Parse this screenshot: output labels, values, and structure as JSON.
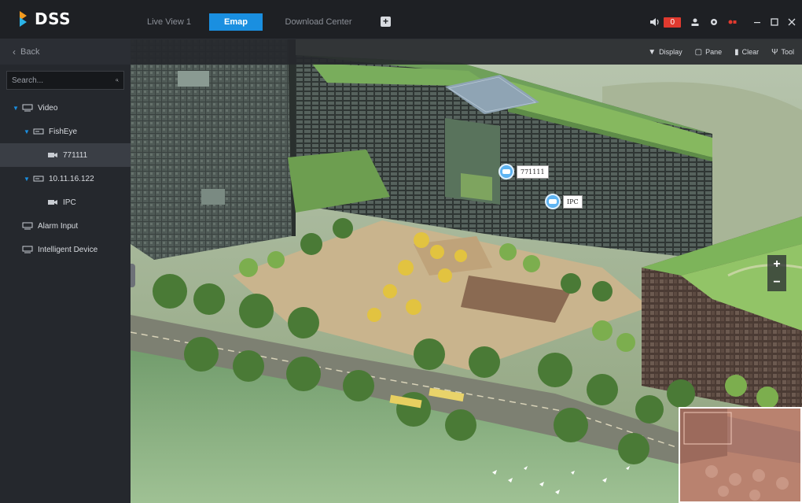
{
  "app": {
    "logo_text": "DSS"
  },
  "tabs": [
    {
      "label": "Live View 1",
      "active": false
    },
    {
      "label": "Emap",
      "active": true
    },
    {
      "label": "Download Center",
      "active": false
    }
  ],
  "header": {
    "alarm_count": "0"
  },
  "sidebar": {
    "back_label": "Back",
    "search_placeholder": "Search...",
    "tree": {
      "video": "Video",
      "fisheye": "FishEye",
      "fisheye_child": "771111",
      "ip_node": "10.11.16.122",
      "ip_child": "IPC",
      "alarm_input": "Alarm Input",
      "intelligent_device": "Intelligent Device"
    }
  },
  "toolbar": {
    "display": "Display",
    "pane": "Pane",
    "clear": "Clear",
    "tool": "Tool"
  },
  "map": {
    "markers": [
      "771111",
      "IPC"
    ],
    "zoom_in": "+",
    "zoom_out": "−"
  },
  "colors": {
    "accent": "#1a8fe0",
    "alarm": "#e03a2f",
    "topbar": "#1e2024",
    "sidebar": "#25282d"
  }
}
